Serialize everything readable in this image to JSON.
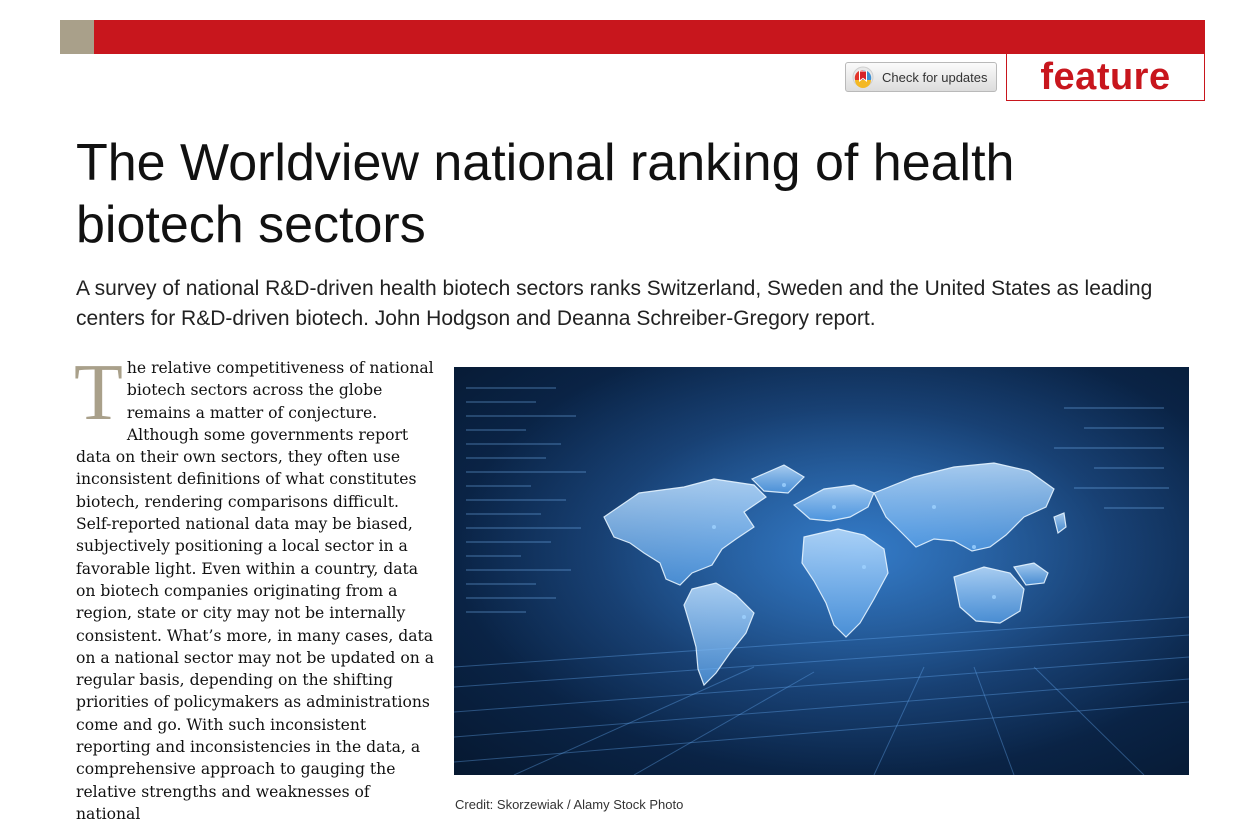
{
  "header": {
    "check_updates_label": "Check for updates",
    "section_label": "feature",
    "accent_color": "#c8161d",
    "tan_color": "#a9a08a"
  },
  "article": {
    "title": "The Worldview national ranking of health biotech sectors",
    "standfirst": "A survey of national R&D-driven health biotech sectors ranks Switzerland, Sweden and the United States as leading centers for R&D-driven biotech. John Hodgson and Deanna Schreiber-Gregory report.",
    "dropcap": "T",
    "body_rest": "he relative competitiveness of national biotech sectors across the globe remains a matter of conjecture. Although some governments report data on their own sectors, they often use inconsistent definitions of what constitutes biotech, rendering comparisons difficult. Self-reported national data may be biased, subjectively positioning a local sector in a favorable light. Even within a country, data on biotech companies originating from a region, state or city may not be internally consistent. What’s more, in many cases, data on a national sector may not be updated on a regular basis, depending on the shifting priorities of policymakers as administrations come and go. With such inconsistent reporting and inconsistencies in the data, a comprehensive approach to gauging the relative strengths and weaknesses of national"
  },
  "figure": {
    "credit": "Credit: Skorzewiak / Alamy Stock Photo"
  }
}
